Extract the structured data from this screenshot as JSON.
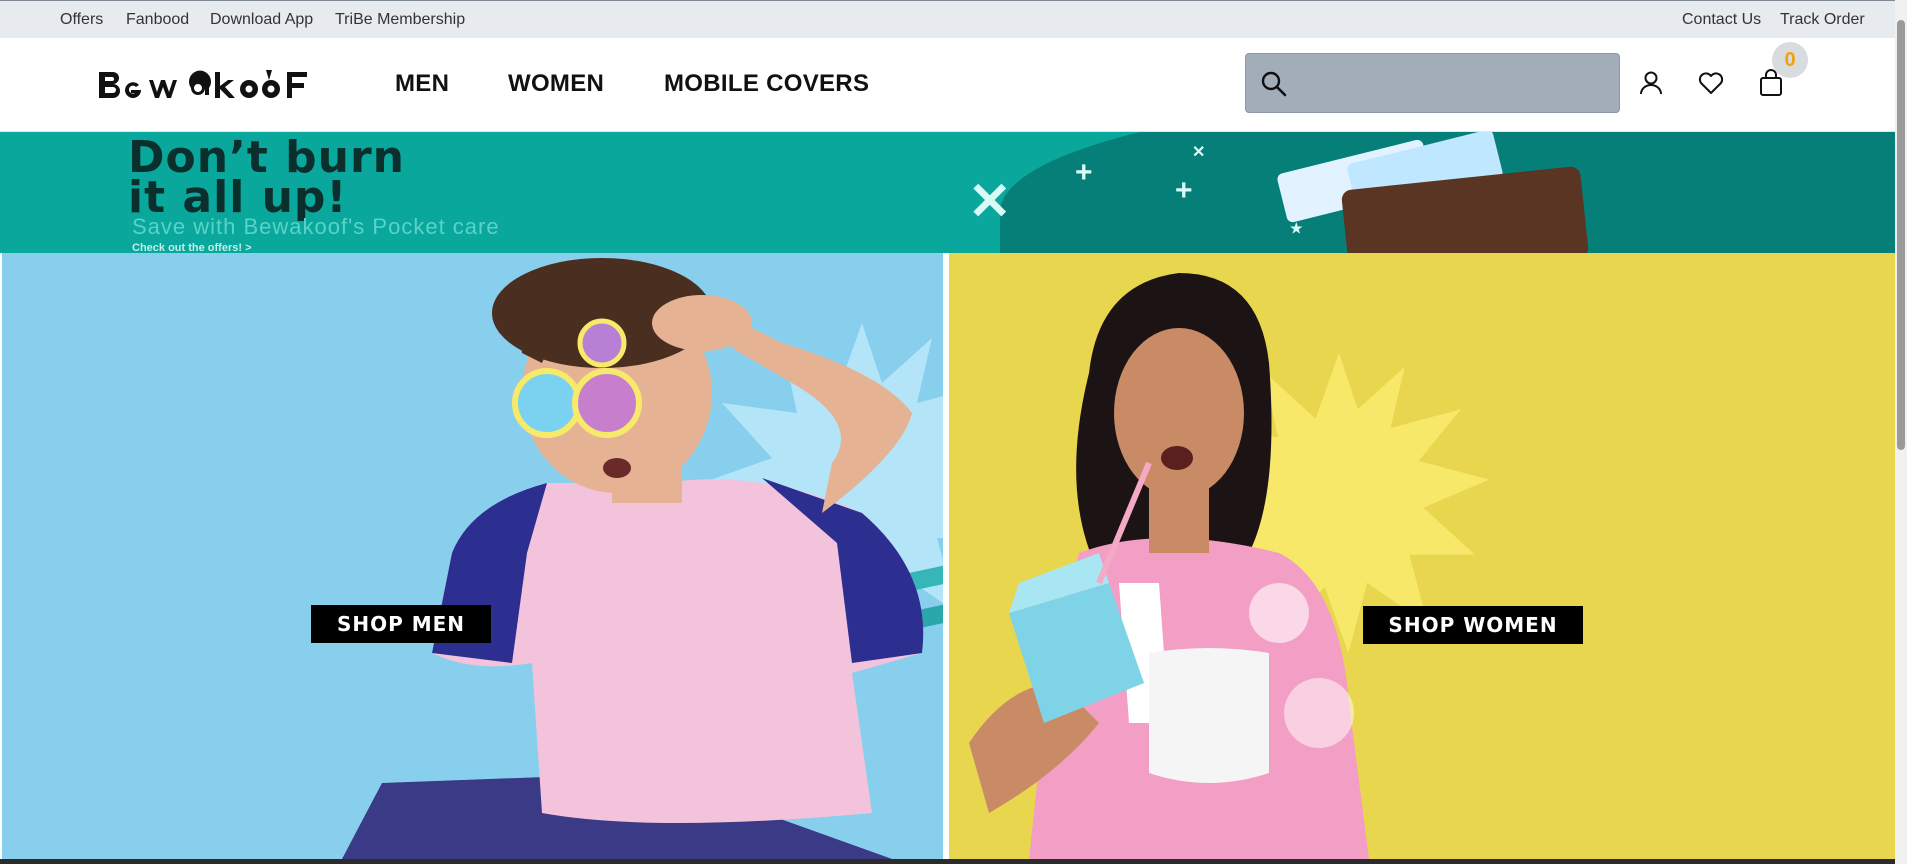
{
  "topbar": {
    "links_left": [
      "Offers",
      "Fanbood",
      "Download App",
      "TriBe Membership"
    ],
    "links_right": [
      "Contact Us",
      "Track Order"
    ]
  },
  "header": {
    "logo_text": "Bewakoof",
    "nav": [
      "MEN",
      "WOMEN",
      "MOBILE COVERS"
    ],
    "search_placeholder": "",
    "cart_count": "0"
  },
  "promo": {
    "headline_line1": "Don’t burn",
    "headline_line2": "it all up!",
    "subline": "Save with Bewakoof's Pocket care",
    "cta": "Check out the offers! >"
  },
  "panels": {
    "men_button": "SHOP MEN",
    "women_button": "SHOP WOMEN"
  },
  "colors": {
    "topbar_bg": "#e7ebf0",
    "promo_bg": "#0aa79d",
    "men_bg": "#88cfee",
    "women_bg": "#e9d64f",
    "badge_text": "#f0a30a"
  },
  "icons": [
    "search-icon",
    "user-icon",
    "heart-icon",
    "shopping-bag-icon"
  ]
}
